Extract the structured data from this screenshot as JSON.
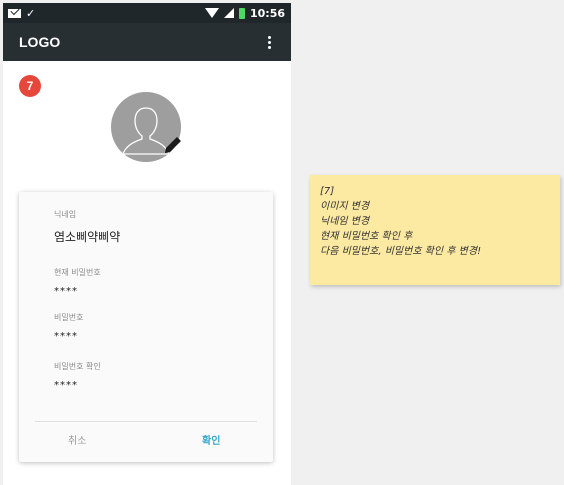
{
  "status_bar": {
    "time": "10:56",
    "check": "✓"
  },
  "app_bar": {
    "logo": "LOGO"
  },
  "badge": "7",
  "form": {
    "nickname_label": "닉네임",
    "nickname_value": "염소삐약삐약",
    "current_password_label": "현재 비밀번호",
    "current_password_value": "****",
    "password_label": "비밀번호",
    "password_value": "****",
    "password_confirm_label": "비밀번호 확인",
    "password_confirm_value": "****",
    "cancel_label": "취소",
    "confirm_label": "확인"
  },
  "note": {
    "lines": [
      "[7]",
      "이미지 변경",
      "닉네임 변경",
      "현재 비밀번호 확인 후",
      "다음 비밀번호, 비밀번호 확인 후 변경!"
    ]
  },
  "colors": {
    "app_bar": "#272f33",
    "status_bar": "#20272a",
    "badge": "#e7473b",
    "accent": "#3aa8c9",
    "note": "#fce9a2"
  },
  "icons": [
    "mail-icon",
    "check-icon",
    "wifi-icon",
    "signal-icon",
    "battery-icon",
    "kebab-icon",
    "avatar-icon",
    "edit-icon"
  ]
}
